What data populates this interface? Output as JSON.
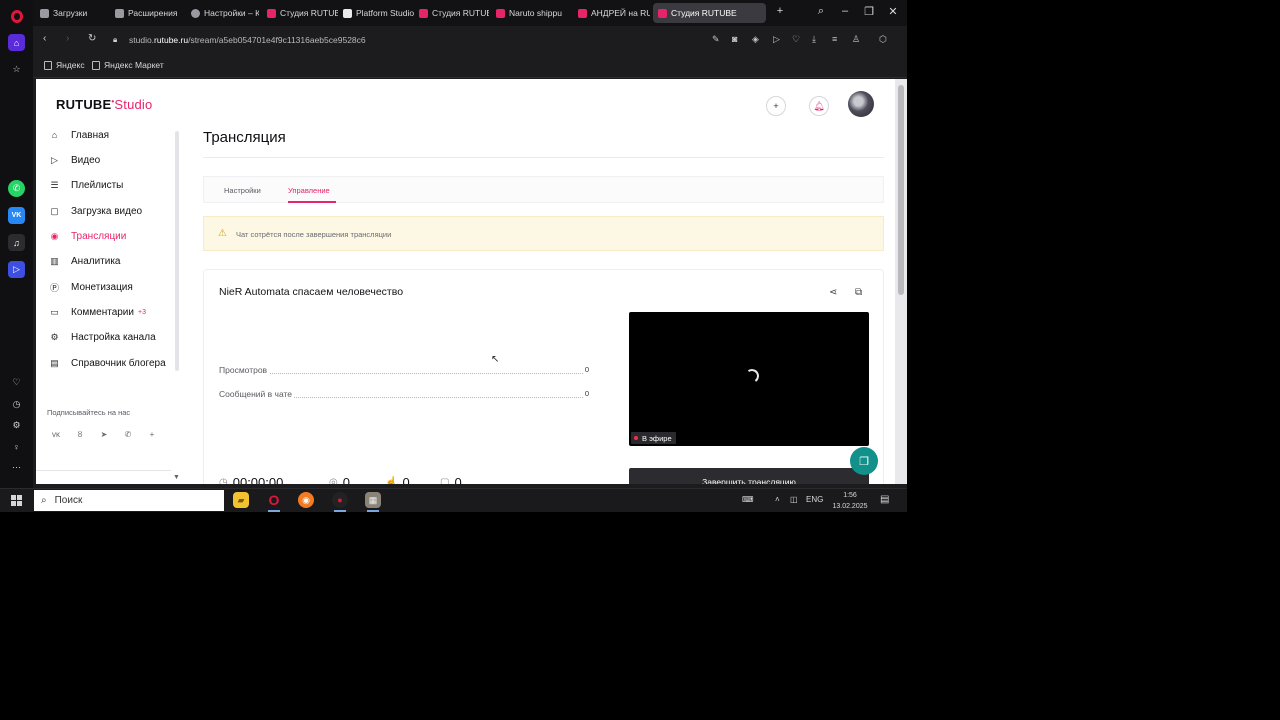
{
  "browser": {
    "tabs": [
      {
        "label": "Загрузки",
        "color": "#9a9aa0"
      },
      {
        "label": "Расширения",
        "color": "#9a9aa0"
      },
      {
        "label": "Настройки – К",
        "color": "#9a9aa0"
      },
      {
        "label": "Студия RUTUBE",
        "color": "#e6246a"
      },
      {
        "label": "Platform Studio",
        "color": "#ffffff"
      },
      {
        "label": "Студия RUTUBE",
        "color": "#e6246a"
      },
      {
        "label": "Naruto shippu",
        "color": "#e6246a"
      },
      {
        "label": "АНДРЕЙ на RU",
        "color": "#e6246a"
      },
      {
        "label": "Студия RUTUBE",
        "color": "#e6246a"
      }
    ],
    "new_tab": "+",
    "url_prefix": "studio.",
    "url_domain": "rutube.ru",
    "url_path": "/stream/a5eb054701e4f9c11316aeb5ce9528c6",
    "bookmarks": [
      "Яндекс",
      "Яндекс Маркет"
    ]
  },
  "app": {
    "logo_main": "RUTUBE",
    "logo_studio": "Studio",
    "accent_color": "#e6246a"
  },
  "sidebar": {
    "items": [
      {
        "label": "Главная",
        "icon": "home-icon"
      },
      {
        "label": "Видео",
        "icon": "video-icon"
      },
      {
        "label": "Плейлисты",
        "icon": "playlist-icon"
      },
      {
        "label": "Загрузка видео",
        "icon": "upload-icon"
      },
      {
        "label": "Трансляции",
        "icon": "broadcast-icon",
        "active": true
      },
      {
        "label": "Аналитика",
        "icon": "analytics-icon"
      },
      {
        "label": "Монетизация",
        "icon": "monetization-icon"
      },
      {
        "label": "Комментарии",
        "icon": "comments-icon",
        "badge": "+3"
      },
      {
        "label": "Настройка канала",
        "icon": "gear-icon"
      },
      {
        "label": "Справочник блогера",
        "icon": "book-icon"
      }
    ],
    "subscribe_label": "Подписывайтесь на нас",
    "socials": [
      "vk",
      "ok",
      "telegram",
      "viber",
      "more"
    ]
  },
  "main": {
    "page_title": "Трансляция",
    "tabs": [
      {
        "label": "Настройки"
      },
      {
        "label": "Управление",
        "active": true
      }
    ],
    "notice": "Чат сотрётся после завершения трансляции",
    "stream": {
      "title": "NieR Automata спасаем человечество",
      "stats": [
        {
          "label": "Просмотров",
          "value": "0"
        },
        {
          "label": "Сообщений в чате",
          "value": "0"
        }
      ],
      "live_label": "В эфире",
      "end_button": "Завершить трансляцию",
      "bottom_stats": [
        {
          "icon": "timer-icon",
          "value": "00:00:00"
        },
        {
          "icon": "eye-icon",
          "value": "0"
        },
        {
          "icon": "like-icon",
          "value": "0"
        },
        {
          "icon": "chat-icon",
          "value": "0"
        }
      ]
    }
  },
  "taskbar": {
    "search_placeholder": "Поиск",
    "lang": "ENG",
    "time": "1:56",
    "date": "13.02.2025"
  }
}
